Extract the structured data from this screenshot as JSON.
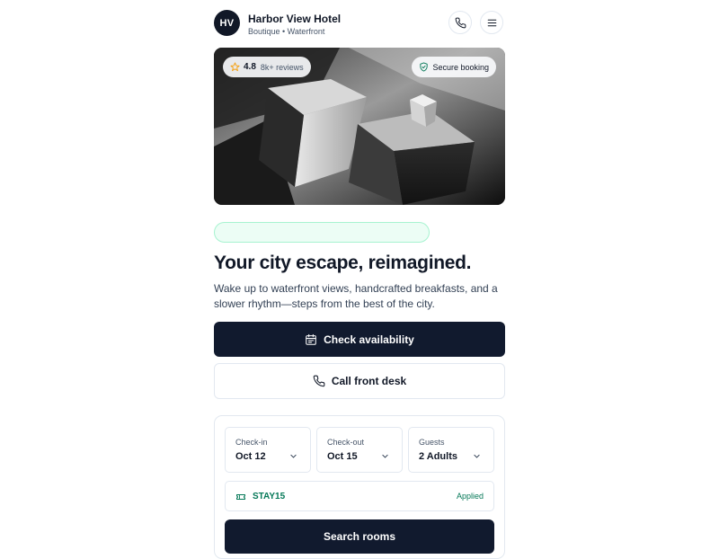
{
  "header": {
    "avatar_initials": "HV",
    "hotel_name": "Harbor View Hotel",
    "hotel_tagline": "Boutique • Waterfront",
    "phone_icon": "phone-icon",
    "menu_icon": "menu-icon"
  },
  "hero": {
    "rating": {
      "icon": "star-icon",
      "value": "4.8",
      "reviews": "8k+ reviews"
    },
    "secure": {
      "icon": "shield-check-icon",
      "label": "Secure booking"
    }
  },
  "headline": "Your city escape, reimagined.",
  "description": "Wake up to waterfront views, handcrafted breakfasts, and a slower rhythm—steps from the best of the city.",
  "actions": {
    "check_availability": {
      "icon": "calendar-icon",
      "label": "Check availability"
    },
    "call_front_desk": {
      "icon": "phone-icon",
      "label": "Call front desk"
    }
  },
  "booking": {
    "fields": [
      {
        "label": "Check-in",
        "value": "Oct 12"
      },
      {
        "label": "Check-out",
        "value": "Oct 15"
      },
      {
        "label": "Guests",
        "value": "2 Adults"
      }
    ],
    "promo": {
      "icon": "ticket-icon",
      "code": "STAY15",
      "status": "Applied"
    },
    "search_label": "Search rooms"
  },
  "colors": {
    "primary": "#111a2e",
    "accent_green": "#047857",
    "promo_bg": "#ecfdf5",
    "rating_star": "#f59e0b",
    "border": "#e2e8f0"
  }
}
